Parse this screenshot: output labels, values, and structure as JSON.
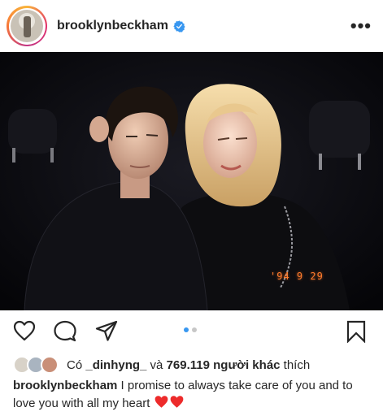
{
  "post": {
    "username": "brooklynbeckham",
    "verified": true
  },
  "header": {
    "more_icon": "•••"
  },
  "photo": {
    "date_stamp": "'94 9 29"
  },
  "carousel": {
    "count": 2,
    "active_index": 0
  },
  "likes": {
    "prefix": "Có",
    "first_liker": "_dinhyng_",
    "conjunction": "và",
    "others_count": "769.119 người khác",
    "suffix": "thích"
  },
  "caption": {
    "username": "brooklynbeckham",
    "text": "I promise to always take care of you and to love you with all my heart",
    "emoji": [
      "red-heart-icon",
      "red-heart-icon"
    ]
  },
  "colors": {
    "verified": "#3897f0",
    "heart": "#ed2b2b",
    "dot_active": "#3897f0",
    "stamp": "#ff7b2c"
  }
}
